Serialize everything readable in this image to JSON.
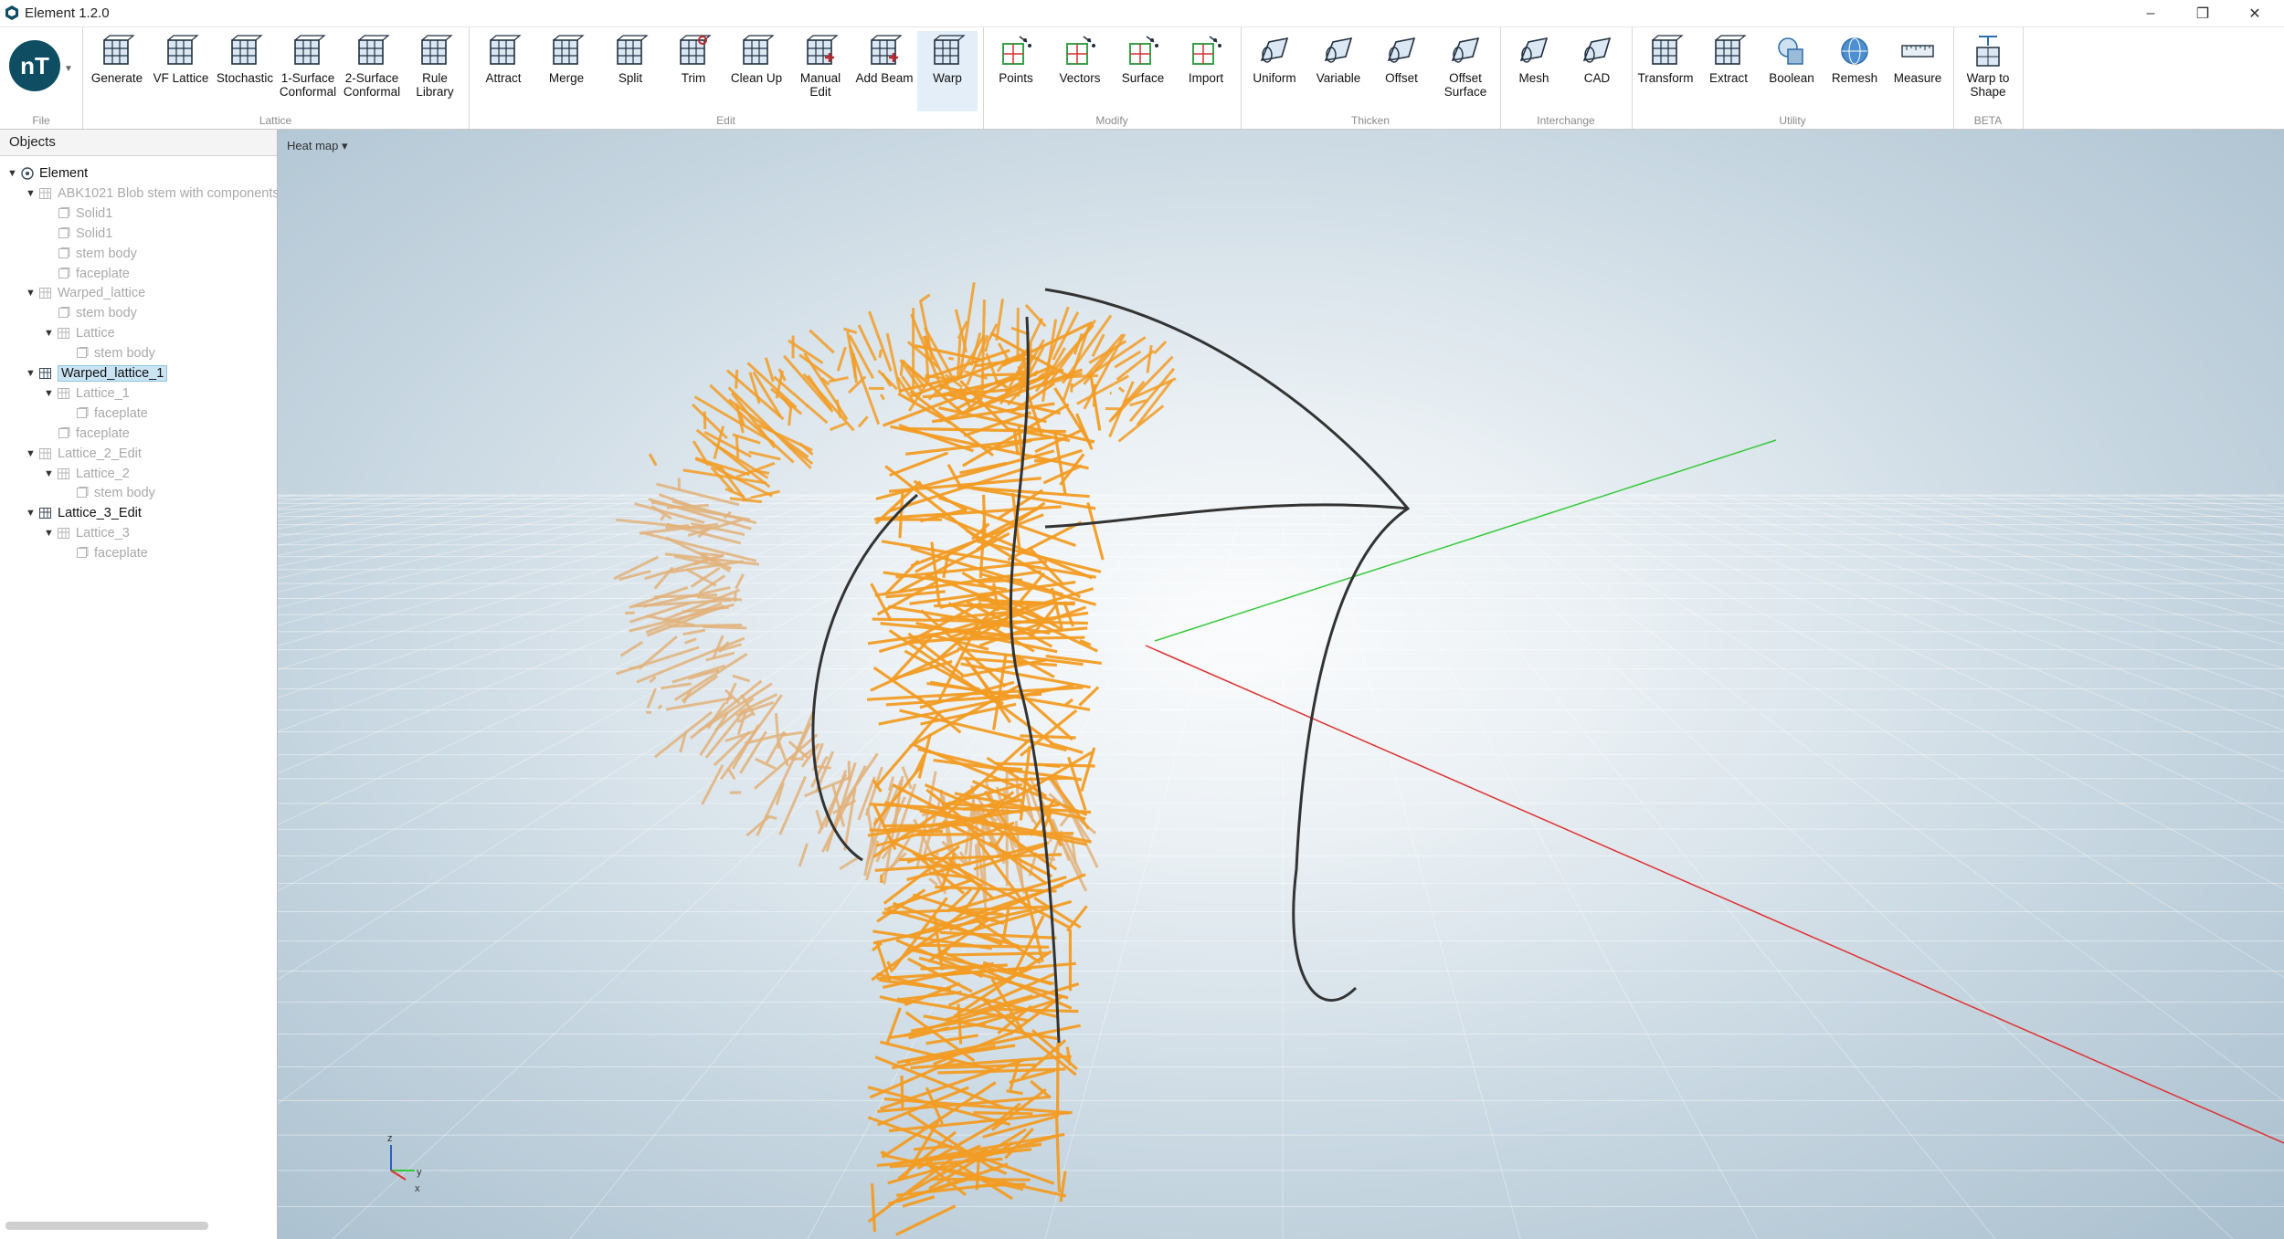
{
  "window": {
    "title": "Element 1.2.0",
    "controls": [
      "–",
      "❐",
      "✕"
    ]
  },
  "ribbon": {
    "groups": [
      {
        "label": "File",
        "buttons": []
      },
      {
        "label": "Lattice",
        "buttons": [
          "Generate",
          "VF Lattice",
          "Stochastic",
          "1-Surface\nConformal",
          "2-Surface\nConformal",
          "Rule\nLibrary"
        ]
      },
      {
        "label": "Edit",
        "buttons": [
          "Attract",
          "Merge",
          "Split",
          "Trim",
          "Clean Up",
          "Manual\nEdit",
          "Add Beam",
          "Warp"
        ]
      },
      {
        "label": "Modify",
        "buttons": [
          "Points",
          "Vectors",
          "Surface",
          "Import"
        ]
      },
      {
        "label": "Thicken",
        "buttons": [
          "Uniform",
          "Variable",
          "Offset",
          "Offset\nSurface"
        ]
      },
      {
        "label": "Interchange",
        "buttons": [
          "Mesh",
          "CAD"
        ]
      },
      {
        "label": "Utility",
        "buttons": [
          "Transform",
          "Extract",
          "Boolean",
          "Remesh",
          "Measure"
        ]
      },
      {
        "label": "BETA",
        "buttons": [
          "Warp to\nShape"
        ]
      }
    ],
    "active_button": "Warp",
    "logo_text": "nT"
  },
  "objects_panel": {
    "title": "Objects",
    "tree": [
      {
        "label": "Element",
        "level": 0,
        "state": "normal",
        "expand": true
      },
      {
        "label": "ABK1021 Blob stem with components",
        "level": 1,
        "state": "dim",
        "expand": true
      },
      {
        "label": "Solid1",
        "level": 2,
        "state": "dim",
        "expand": false
      },
      {
        "label": "Solid1",
        "level": 2,
        "state": "dim",
        "expand": false
      },
      {
        "label": "stem body",
        "level": 2,
        "state": "dim",
        "expand": false
      },
      {
        "label": "faceplate",
        "level": 2,
        "state": "dim",
        "expand": false
      },
      {
        "label": "Warped_lattice",
        "level": 1,
        "state": "dim",
        "expand": true
      },
      {
        "label": "stem body",
        "level": 2,
        "state": "dim",
        "expand": false
      },
      {
        "label": "Lattice",
        "level": 2,
        "state": "dim",
        "expand": true
      },
      {
        "label": "stem body",
        "level": 3,
        "state": "dim",
        "expand": false
      },
      {
        "label": "Warped_lattice_1",
        "level": 1,
        "state": "selected",
        "expand": true
      },
      {
        "label": "Lattice_1",
        "level": 2,
        "state": "dim",
        "expand": true
      },
      {
        "label": "faceplate",
        "level": 3,
        "state": "dim",
        "expand": false
      },
      {
        "label": "faceplate",
        "level": 2,
        "state": "dim",
        "expand": false
      },
      {
        "label": "Lattice_2_Edit",
        "level": 1,
        "state": "dim",
        "expand": true
      },
      {
        "label": "Lattice_2",
        "level": 2,
        "state": "dim",
        "expand": true
      },
      {
        "label": "stem body",
        "level": 3,
        "state": "dim",
        "expand": false
      },
      {
        "label": "Lattice_3_Edit",
        "level": 1,
        "state": "normal",
        "expand": true
      },
      {
        "label": "Lattice_3",
        "level": 2,
        "state": "dim",
        "expand": true
      },
      {
        "label": "faceplate",
        "level": 3,
        "state": "dim",
        "expand": false
      }
    ]
  },
  "viewport": {
    "heatmap_label": "Heat map ▾",
    "axes": {
      "z": "z",
      "y": "y",
      "x": "x"
    },
    "colors": {
      "lattice": "#f29c24",
      "lattice_faded": "#e2b27a",
      "outline": "#333333",
      "x_axis": "#e03030",
      "y_axis": "#35c93a"
    }
  }
}
